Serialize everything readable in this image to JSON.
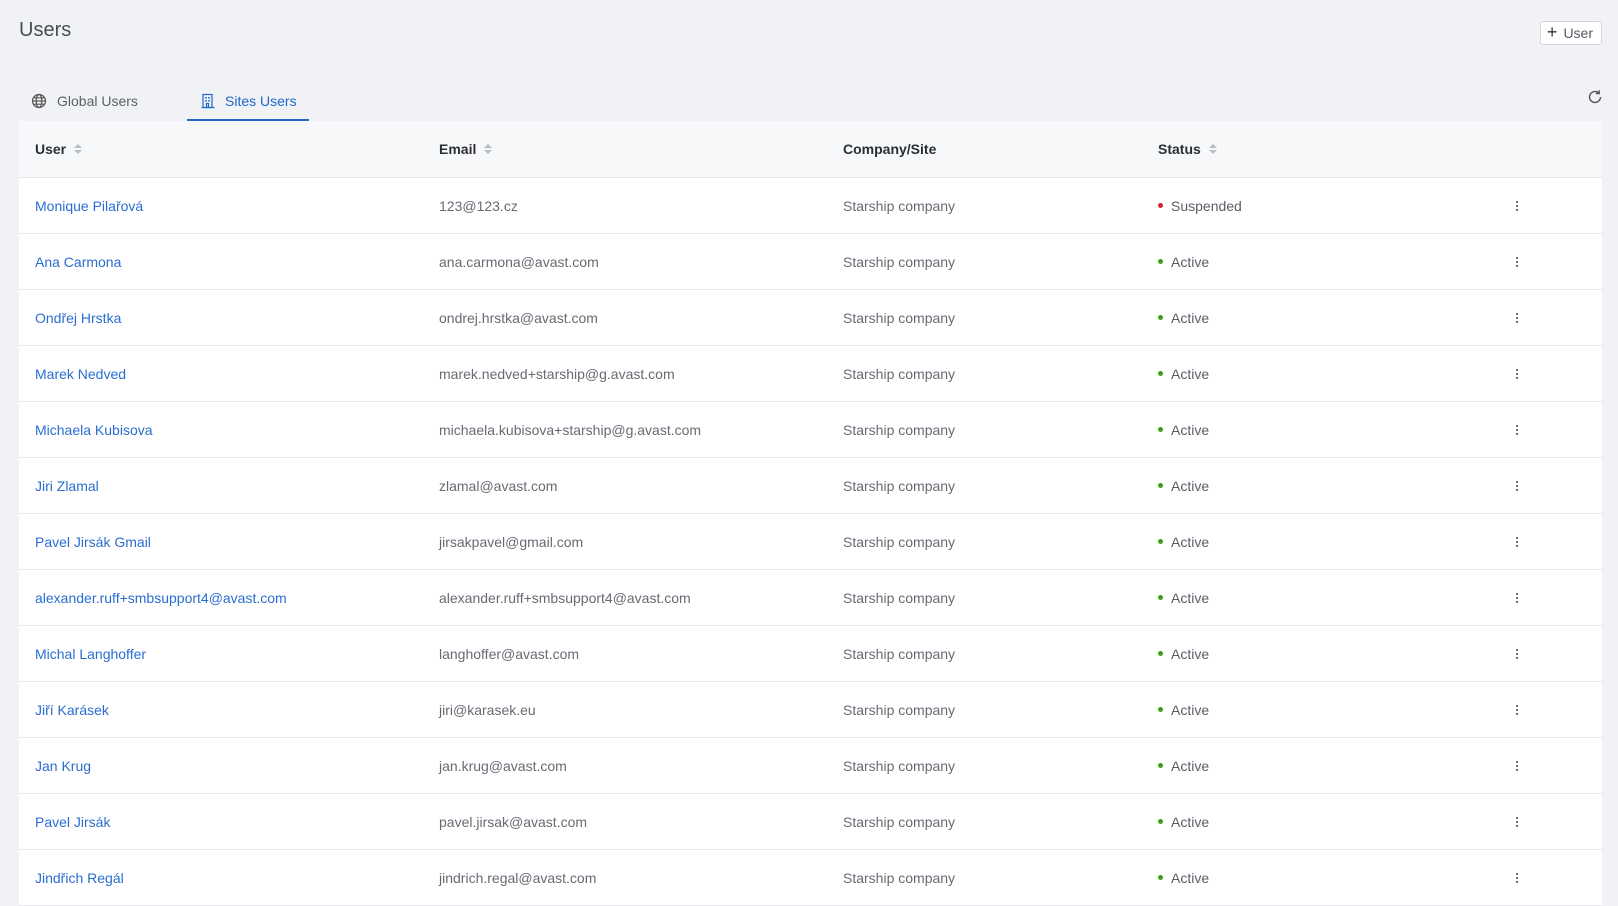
{
  "page": {
    "title": "Users"
  },
  "toolbar": {
    "add_user_label": "User"
  },
  "tabs": [
    {
      "label": "Global Users",
      "icon": "globe-icon",
      "active": false
    },
    {
      "label": "Sites Users",
      "icon": "building-icon",
      "active": true
    }
  ],
  "table": {
    "columns": {
      "user": "User",
      "email": "Email",
      "company": "Company/Site",
      "status": "Status"
    },
    "rows": [
      {
        "user": "Monique Pilařová",
        "email": "123@123.cz",
        "company": "Starship company",
        "status": "Suspended"
      },
      {
        "user": "Ana Carmona",
        "email": "ana.carmona@avast.com",
        "company": "Starship company",
        "status": "Active"
      },
      {
        "user": "Ondřej Hrstka",
        "email": "ondrej.hrstka@avast.com",
        "company": "Starship company",
        "status": "Active"
      },
      {
        "user": "Marek Nedved",
        "email": "marek.nedved+starship@g.avast.com",
        "company": "Starship company",
        "status": "Active"
      },
      {
        "user": "Michaela Kubisova",
        "email": "michaela.kubisova+starship@g.avast.com",
        "company": "Starship company",
        "status": "Active"
      },
      {
        "user": "Jiri Zlamal",
        "email": "zlamal@avast.com",
        "company": "Starship company",
        "status": "Active"
      },
      {
        "user": "Pavel Jirsák Gmail",
        "email": "jirsakpavel@gmail.com",
        "company": "Starship company",
        "status": "Active"
      },
      {
        "user": "alexander.ruff+smbsupport4@avast.com",
        "email": "alexander.ruff+smbsupport4@avast.com",
        "company": "Starship company",
        "status": "Active"
      },
      {
        "user": "Michal Langhoffer",
        "email": "langhoffer@avast.com",
        "company": "Starship company",
        "status": "Active"
      },
      {
        "user": "Jiří Karásek",
        "email": "jiri@karasek.eu",
        "company": "Starship company",
        "status": "Active"
      },
      {
        "user": "Jan Krug",
        "email": "jan.krug@avast.com",
        "company": "Starship company",
        "status": "Active"
      },
      {
        "user": "Pavel Jirsák",
        "email": "pavel.jirsak@avast.com",
        "company": "Starship company",
        "status": "Active"
      },
      {
        "user": "Jindřich Regál",
        "email": "jindrich.regal@avast.com",
        "company": "Starship company",
        "status": "Active"
      }
    ]
  },
  "colors": {
    "accent": "#1f67c9",
    "link": "#2a6dd0",
    "status_active": "#3aa21a",
    "status_suspended": "#d6202f"
  }
}
